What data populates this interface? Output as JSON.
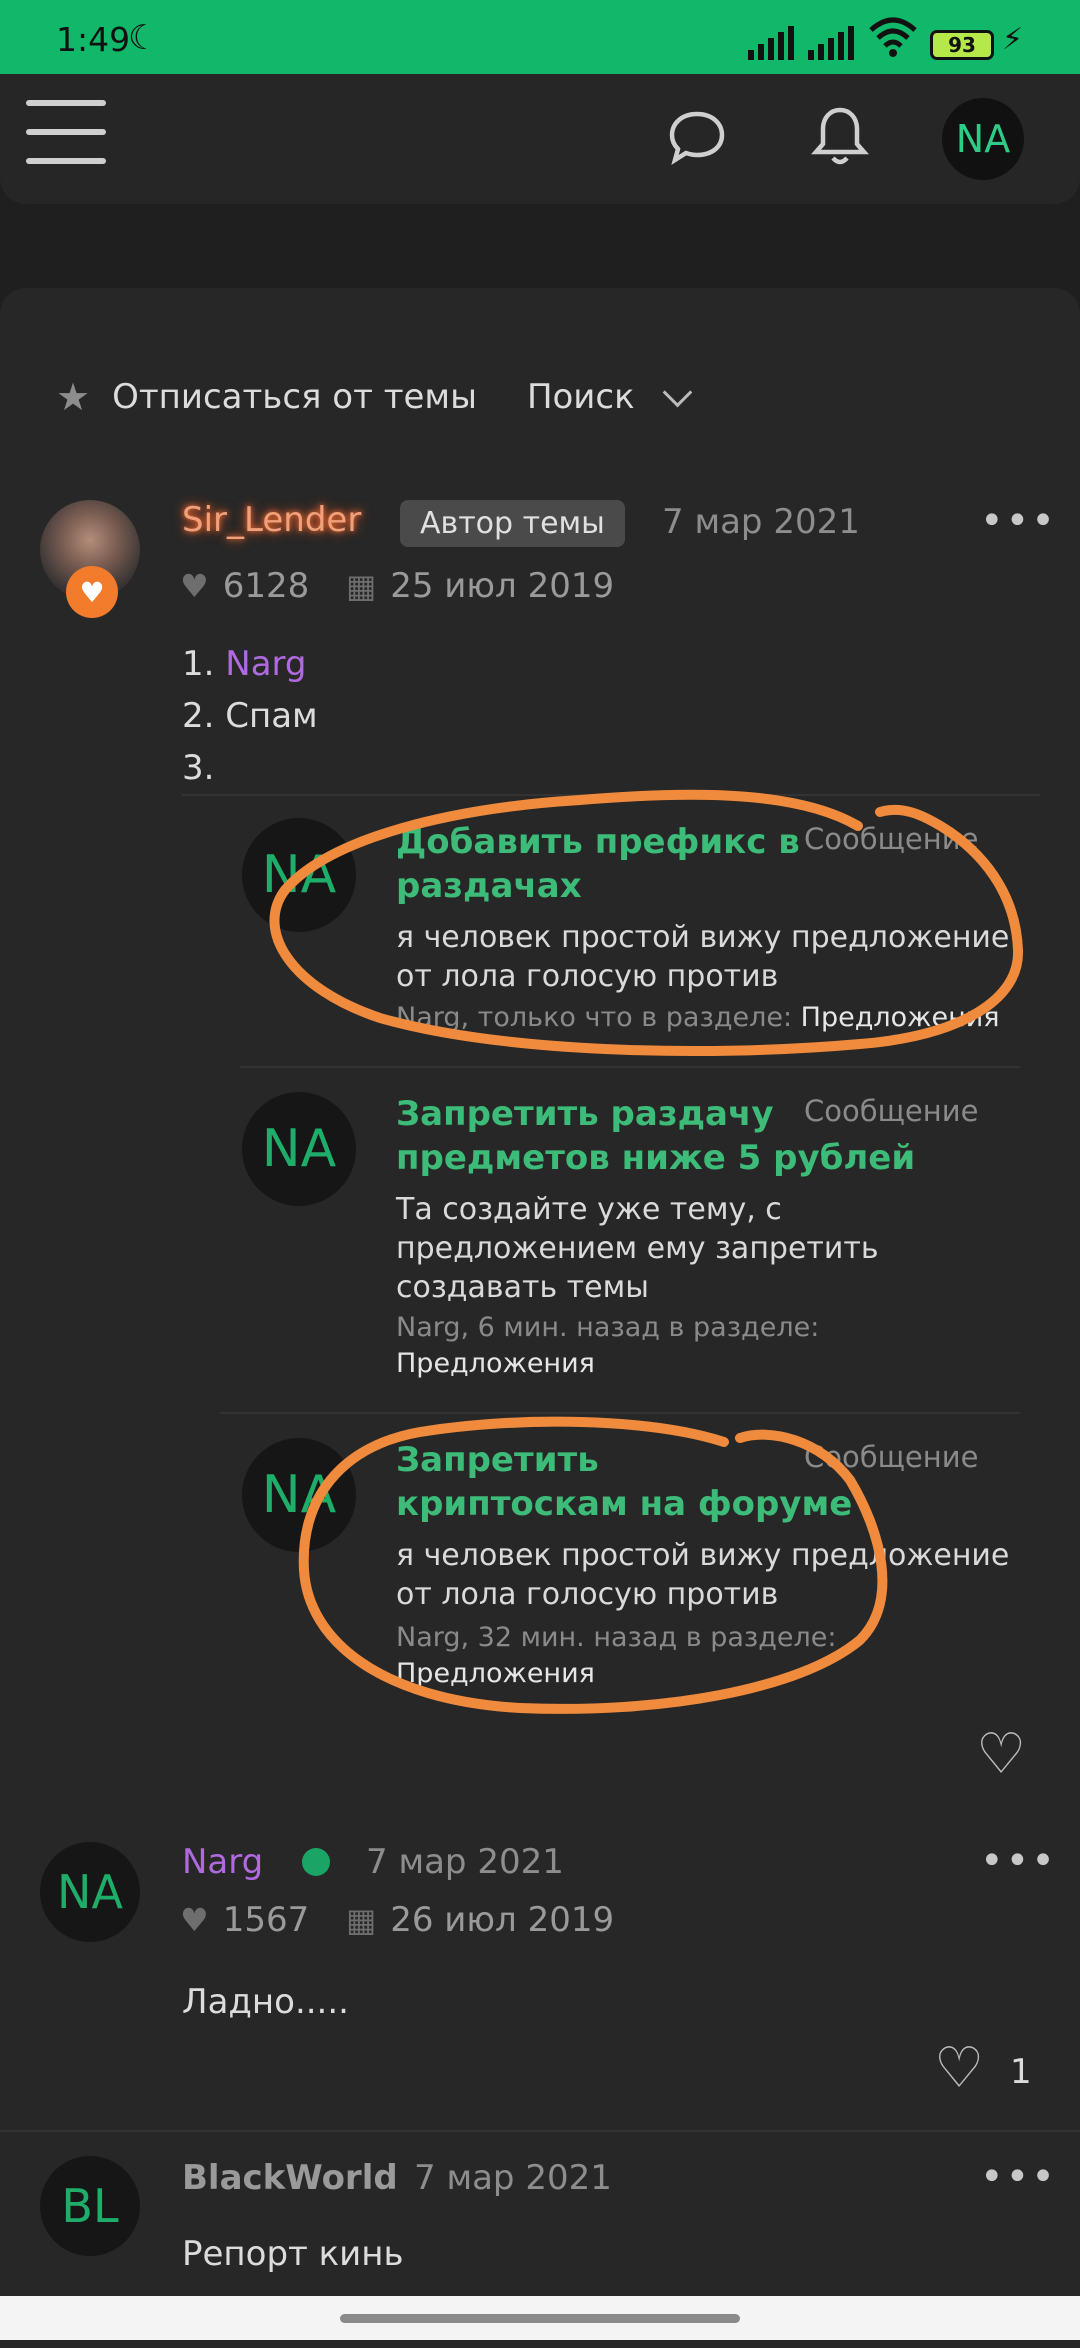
{
  "status_bar": {
    "time": "1:49",
    "battery": "93"
  },
  "header": {
    "avatar_initials": "NA"
  },
  "toolbar": {
    "unsubscribe": "Отписаться от темы",
    "search": "Поиск"
  },
  "post1": {
    "username": "Sir_Lender",
    "badge": "Автор темы",
    "date": "7 мар 2021",
    "likes": "6128",
    "joined": "25 июл 2019",
    "lines": [
      "1.",
      "Narg",
      "2. Спам",
      "3."
    ]
  },
  "quotes": [
    {
      "initials": "NA",
      "title_line1": "Добавить префикс в",
      "title_line2": "раздачах",
      "tag": "Сообщение",
      "text_line1": "я человек простой вижу предложение",
      "text_line2": "от лола голосую против",
      "meta": "Narg, только что в разделе:",
      "section": "Предложения"
    },
    {
      "initials": "NA",
      "title_line1": "Запретить раздачу",
      "title_line2": "предметов ниже 5 рублей",
      "tag": "Сообщение",
      "text_line1": "Та создайте уже тему, с",
      "text_line2": "предложением ему запретить",
      "text_line3": "создавать темы",
      "meta": "Narg, 6 мин. назад в разделе:",
      "section": "Предложения"
    },
    {
      "initials": "NA",
      "title_line1": "Запретить",
      "title_line2": "криптоскам на форуме",
      "tag": "Сообщение",
      "text_line1": "я человек простой вижу предложение",
      "text_line2": "от лола голосую против",
      "meta": "Narg, 32 мин. назад в разделе:",
      "section": "Предложения"
    }
  ],
  "post2": {
    "initials": "NA",
    "username": "Narg",
    "date": "7 мар 2021",
    "likes": "1567",
    "joined": "26 июл 2019",
    "text": "Ладно.....",
    "reactions": "1"
  },
  "post3": {
    "initials": "BL",
    "username": "BlackWorld",
    "date": "7 мар 2021",
    "text": "Репорт кинь"
  },
  "colors": {
    "accent_green": "#12b86a",
    "highlight_orange": "#f08a3c",
    "user_purple": "#b06ae0"
  }
}
